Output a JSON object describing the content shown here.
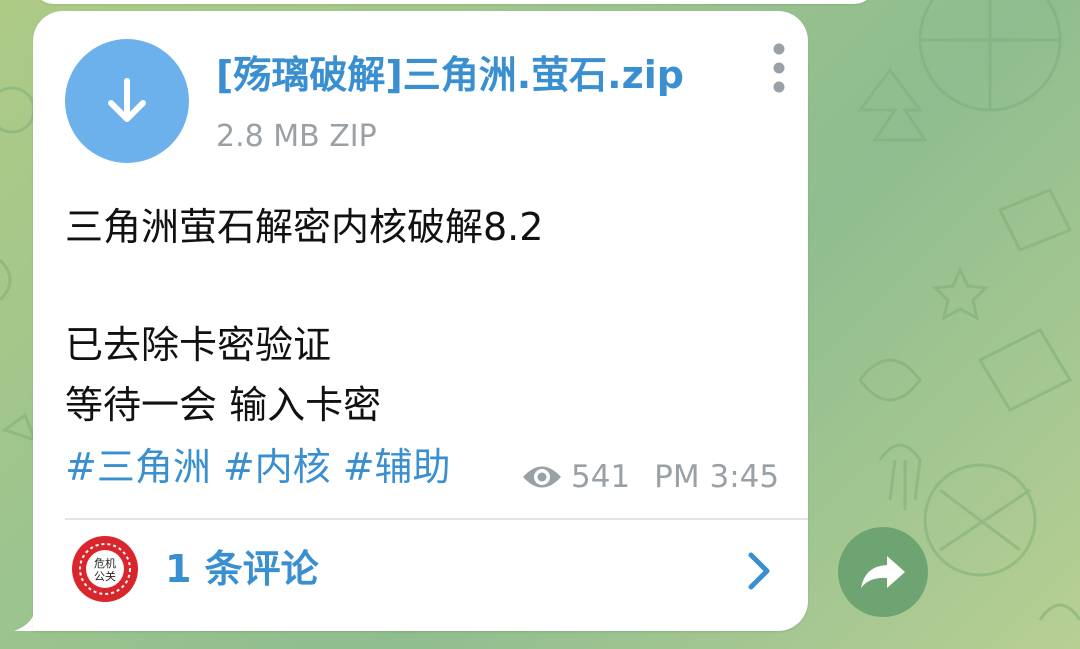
{
  "file": {
    "name": "[殇璃破解]三角洲.萤石.zip",
    "meta": "2.8 MB ZIP"
  },
  "message": {
    "line1": "三角洲萤石解密内核破解8.2",
    "line2": "已去除卡密验证",
    "line3": "等待一会 输入卡密",
    "hashtags": [
      "#三角洲",
      "#内核",
      "#辅助"
    ]
  },
  "status": {
    "views": "541",
    "time": "PM 3:45"
  },
  "comments": {
    "label": "1 条评论",
    "avatar_text_top": "危机",
    "avatar_text_bottom": "公关"
  },
  "icons": {
    "download": "download-arrow-icon",
    "menu": "more-vertical-icon",
    "views": "eye-icon",
    "chevron": "chevron-right-icon",
    "share": "share-arrow-icon"
  },
  "colors": {
    "accent": "#3a8fd0",
    "download_circle": "#6cb1ec",
    "share_button": "#6ea472",
    "meta_gray": "#9aa1a6",
    "avatar_red": "#d9262c"
  }
}
